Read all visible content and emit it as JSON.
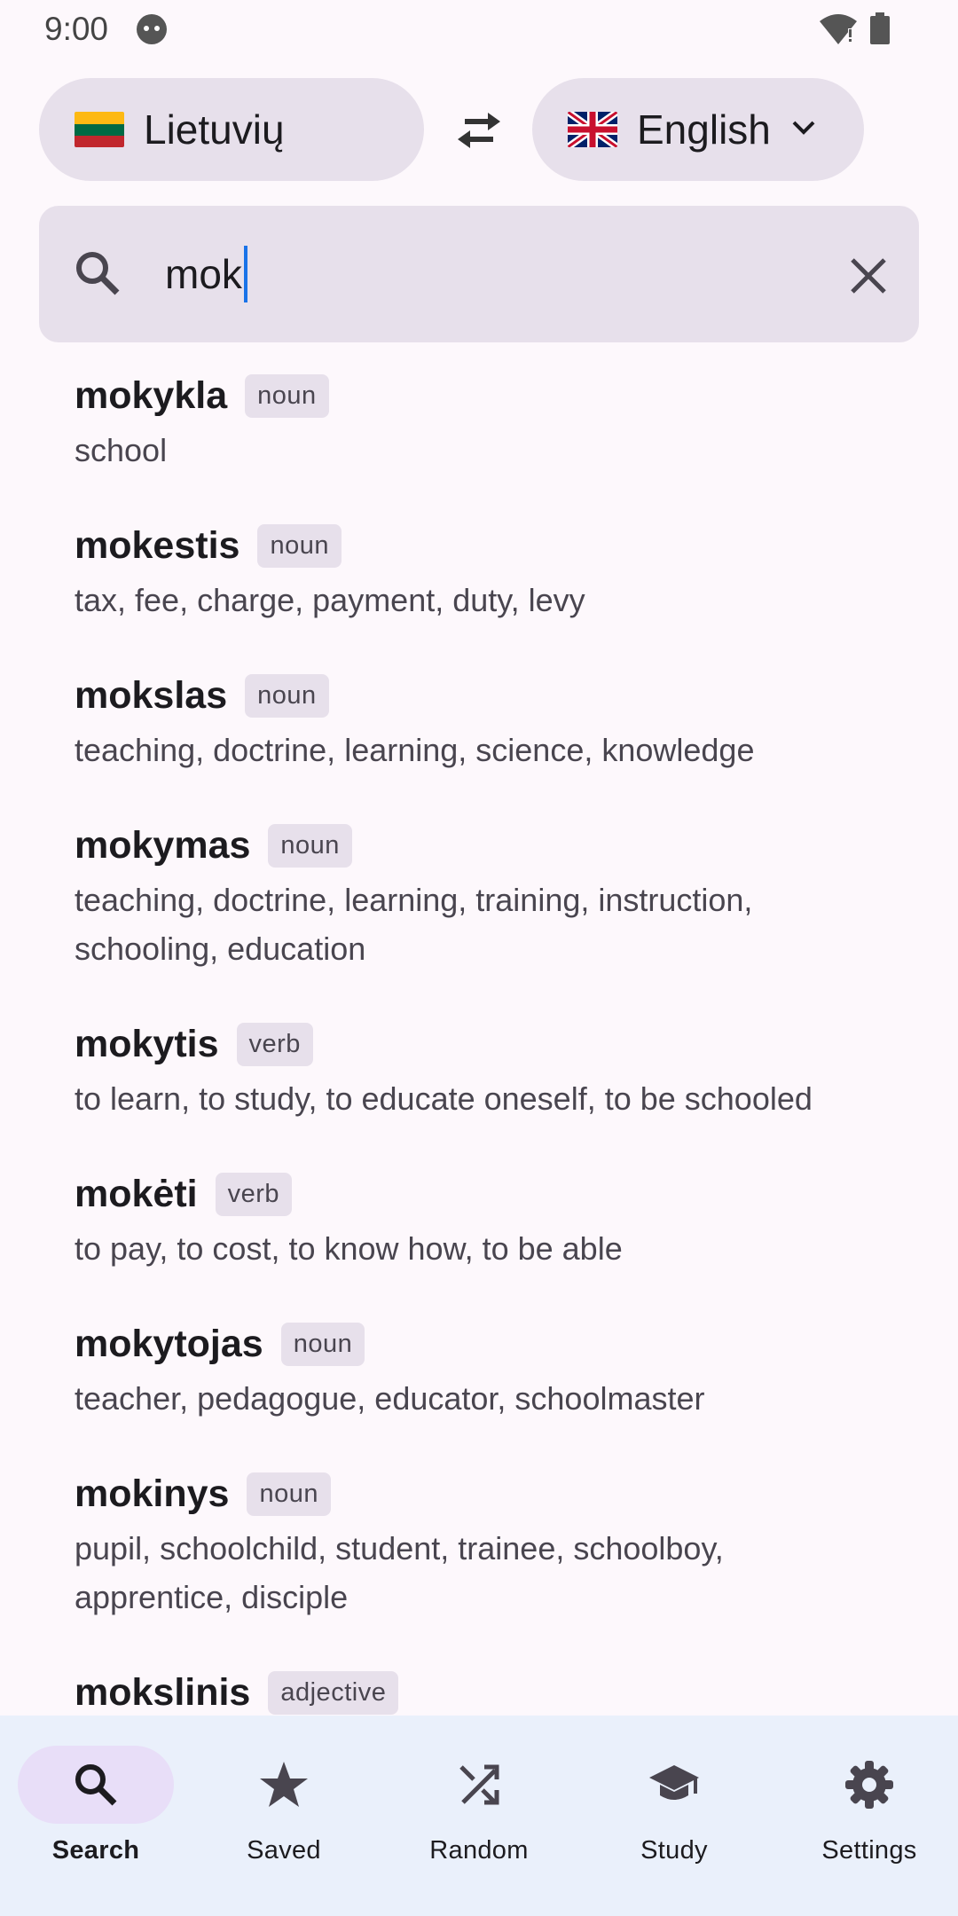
{
  "status": {
    "time": "9:00"
  },
  "languages": {
    "source": {
      "label": "Lietuvių",
      "flag": "lithuania-flag"
    },
    "target": {
      "label": "English",
      "flag": "uk-flag"
    }
  },
  "search": {
    "value": "mok"
  },
  "results": [
    {
      "word": "mokykla",
      "pos": "noun",
      "gloss": "school"
    },
    {
      "word": "mokestis",
      "pos": "noun",
      "gloss": "tax, fee, charge, payment, duty, levy"
    },
    {
      "word": "mokslas",
      "pos": "noun",
      "gloss": "teaching, doctrine, learning, science, knowledge"
    },
    {
      "word": "mokymas",
      "pos": "noun",
      "gloss": "teaching, doctrine, learning, training, instruction, schooling, education"
    },
    {
      "word": "mokytis",
      "pos": "verb",
      "gloss": "to learn, to study, to educate oneself, to be schooled"
    },
    {
      "word": "mokėti",
      "pos": "verb",
      "gloss": "to pay, to cost, to know how, to be able"
    },
    {
      "word": "mokytojas",
      "pos": "noun",
      "gloss": "teacher, pedagogue, educator, schoolmaster"
    },
    {
      "word": "mokinys",
      "pos": "noun",
      "gloss": "pupil, schoolchild, student, trainee, schoolboy, apprentice, disciple"
    },
    {
      "word": "mokslinis",
      "pos": "adjective",
      "gloss": ""
    }
  ],
  "nav": [
    {
      "label": "Search",
      "icon": "search-icon",
      "active": true
    },
    {
      "label": "Saved",
      "icon": "star-icon",
      "active": false
    },
    {
      "label": "Random",
      "icon": "shuffle-icon",
      "active": false
    },
    {
      "label": "Study",
      "icon": "graduation-cap-icon",
      "active": false
    },
    {
      "label": "Settings",
      "icon": "gear-icon",
      "active": false
    }
  ],
  "colors": {
    "accent": "#1a73e8",
    "pill": "#e7e0eb",
    "nav_bg": "#eaf0fb",
    "nav_active": "#e8def8"
  }
}
